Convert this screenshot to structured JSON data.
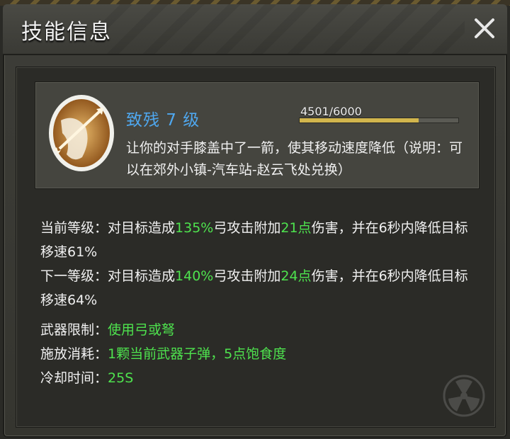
{
  "header": {
    "title": "技能信息",
    "close_icon": "close-icon"
  },
  "skill": {
    "name": "致残 7 级",
    "exp_text": "4501/6000",
    "exp_fraction": 0.7502,
    "description": "让你的对手膝盖中了一箭，使其移动速度降低（说明：可以在郊外小镇-汽车站-赵云飞处兑换）",
    "icon": "arrow-knee-icon"
  },
  "current_level": {
    "label": "当前等级：",
    "p1": "对目标造成",
    "v1": "135%",
    "p2": "弓攻击附加",
    "v2": "21点",
    "p3": "伤害，并在6秒内降低目标移速61%"
  },
  "next_level": {
    "label": "下一等级：",
    "p1": "对目标造成",
    "v1": "140%",
    "p2": "弓攻击附加",
    "v2": "24点",
    "p3": "伤害，并在6秒内降低目标移速64%"
  },
  "weapon_limit": {
    "label": "武器限制：",
    "value": "使用弓或弩"
  },
  "cast_cost": {
    "label": "施放消耗：",
    "value": "1颗当前武器子弹，5点饱食度"
  },
  "cooldown": {
    "label": "冷却时间：",
    "value": "25S"
  },
  "colors": {
    "skill_name": "#4fa7ee",
    "highlight": "#4ee34e",
    "exp_fill": "#d1b54d"
  }
}
